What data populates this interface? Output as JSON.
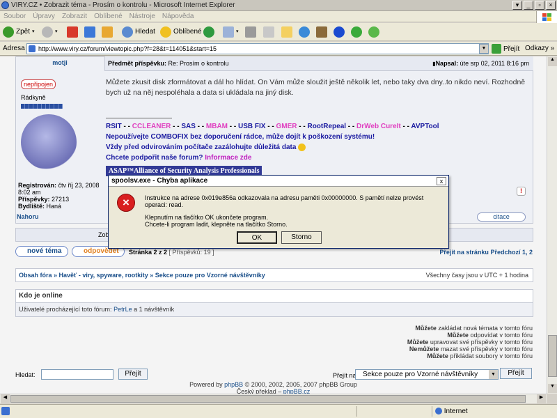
{
  "window": {
    "title": "VIRY.CZ • Zobrazit téma - Prosím o kontrolu - Microsoft Internet Explorer"
  },
  "menu": [
    "Soubor",
    "Úpravy",
    "Zobrazit",
    "Oblíbené",
    "Nástroje",
    "Nápověda"
  ],
  "toolbar": {
    "back": "Zpět",
    "search": "Hledat",
    "favorites": "Oblíbené"
  },
  "address": {
    "label": "Adresa",
    "url": "http://www.viry.cz/forum/viewtopic.php?f=28&t=114051&start=15",
    "go": "Přejít",
    "links": "Odkazy"
  },
  "post": {
    "author": "motji",
    "subject_label": "Předmět příspěvku:",
    "subject": "Re: Prosím o kontrolu",
    "posted_label": "Napsal:",
    "posted": "úte srp 02, 2011 8:16 pm",
    "status": "nepřipojen",
    "rank": "Rádkyně",
    "body": "Můžete zkusit disk zformátovat a dál ho hlídat. On Vám může sloužit ještě několik let, nebo taky dva dny..to nikdo neví. Rozhodně bych už na něj nespoléhala a data si ukládala na jiný disk.",
    "sig_tools": [
      "RSIT",
      "CCLEANER",
      "SAS",
      "MBAM",
      "USB FIX",
      "GMER",
      "RootRepeal",
      "DrWeb CureIt",
      "AVPTool"
    ],
    "sig_line2": "Nepoužívejte COMBOFIX bez doporučení rádce, může dojít k poškození systému!",
    "sig_line3": "Vždy před odvirováním počítače zazálohujte důležitá data",
    "sig_line4a": "Chcete podpořit naše forum?",
    "sig_line4b": "Informace zde",
    "asap": "ASAP™Alliance of Security Analysis Professionals",
    "reg_label": "Registrován:",
    "reg": "čtv říj 23, 2008 8:02 am",
    "posts_label": "Příspěvky:",
    "posts": "27213",
    "loc_label": "Bydliště:",
    "loc": "Haná",
    "top": "Nahoru",
    "quote": "citace"
  },
  "sortbar": {
    "text": "Zob"
  },
  "actions": {
    "new": "nové téma",
    "reply": "odpovědět",
    "page": "Stránka 2 z 2",
    "count": "[ Příspěvků: 19 ]",
    "goto": "Přejít na stránku",
    "prev": "Předchozí",
    "pages": "1, 2"
  },
  "breadcrumb": {
    "path": "Obsah fóra » Havěť - viry, spyware, rootkity » Sekce pouze pro Vzorné návštěvníky",
    "tz": "Všechny časy jsou v UTC + 1 hodina"
  },
  "online": {
    "title": "Kdo je online",
    "text": "Uživatelé procházející toto fórum:",
    "user": "PetrLe",
    "rest": "a 1 návštěvník"
  },
  "permissions": [
    {
      "b": "Můžete",
      "t": " zakládat nová témata v tomto fóru"
    },
    {
      "b": "Můžete",
      "t": " odpovídat v tomto fóru"
    },
    {
      "b": "Můžete",
      "t": " upravovat své příspěvky v tomto fóru"
    },
    {
      "b": "Nemůžete",
      "t": " mazat své příspěvky v tomto fóru"
    },
    {
      "b": "Můžete",
      "t": " přikládat soubory v tomto fóru"
    }
  ],
  "search": {
    "label": "Hledat:",
    "btn": "Přejít",
    "jump_label": "Přejít na:",
    "jump_value": "Sekce pouze pro Vzorné návštěvníky",
    "jump_btn": "Přejít"
  },
  "footer": {
    "line1a": "Powered by",
    "line1b": "phpBB",
    "line1c": "© 2000, 2002, 2005, 2007 phpBB Group",
    "line2a": "Český překlad –",
    "line2b": "phpBB.cz"
  },
  "status": {
    "zone": "Internet"
  },
  "dialog": {
    "title": "spoolsv.exe - Chyba aplikace",
    "close": "x",
    "msg1": "Instrukce na adrese 0x019e856a odkazovala na adresu paměti 0x00000000. S pamětí nelze provést operaci: read.",
    "msg2": "Klepnutím na tlačítko OK ukončete program.",
    "msg3": "Chcete-li program ladit, klepněte na tlačítko Storno.",
    "ok": "OK",
    "cancel": "Storno"
  },
  "colors": {
    "link": "#1a4f8a",
    "tool_pink": "#e040c0",
    "tool_blue": "#1a1aa0",
    "error_red": "#d91f1f"
  }
}
